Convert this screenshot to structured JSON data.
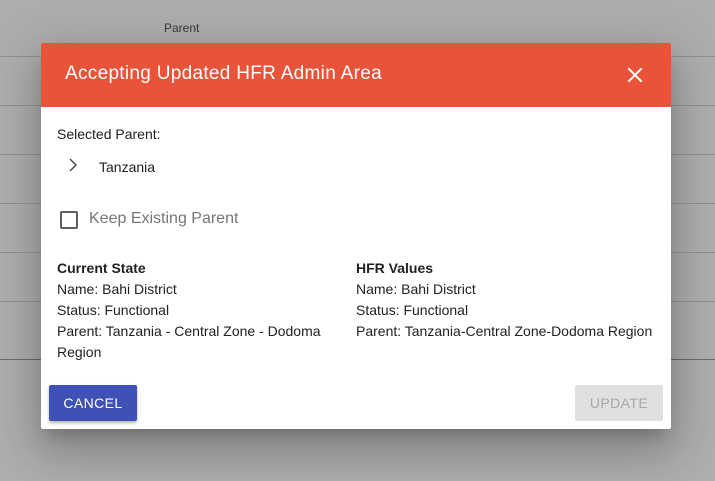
{
  "background": {
    "column_header_parent": "Parent",
    "row_count": 6
  },
  "dialog": {
    "title": "Accepting Updated HFR Admin Area",
    "header_color": "#e8533a",
    "close_icon": "close-icon",
    "selected_parent_label": "Selected Parent:",
    "tree": {
      "expand_icon": "chevron-right-icon",
      "root_label": "Tanzania"
    },
    "keep_existing_parent": {
      "label": "Keep Existing Parent",
      "checked": false
    },
    "current_state": {
      "heading": "Current State",
      "name": "Name: Bahi District",
      "status": "Status: Functional",
      "parent": "Parent: Tanzania - Central Zone - Dodoma Region"
    },
    "hfr_values": {
      "heading": "HFR Values",
      "name": "Name: Bahi District",
      "status": "Status: Functional",
      "parent": "Parent: Tanzania-Central Zone-Dodoma Region"
    },
    "buttons": {
      "cancel": "Cancel",
      "update": "Update",
      "cancel_color": "#3f51b5",
      "update_disabled": true
    }
  }
}
